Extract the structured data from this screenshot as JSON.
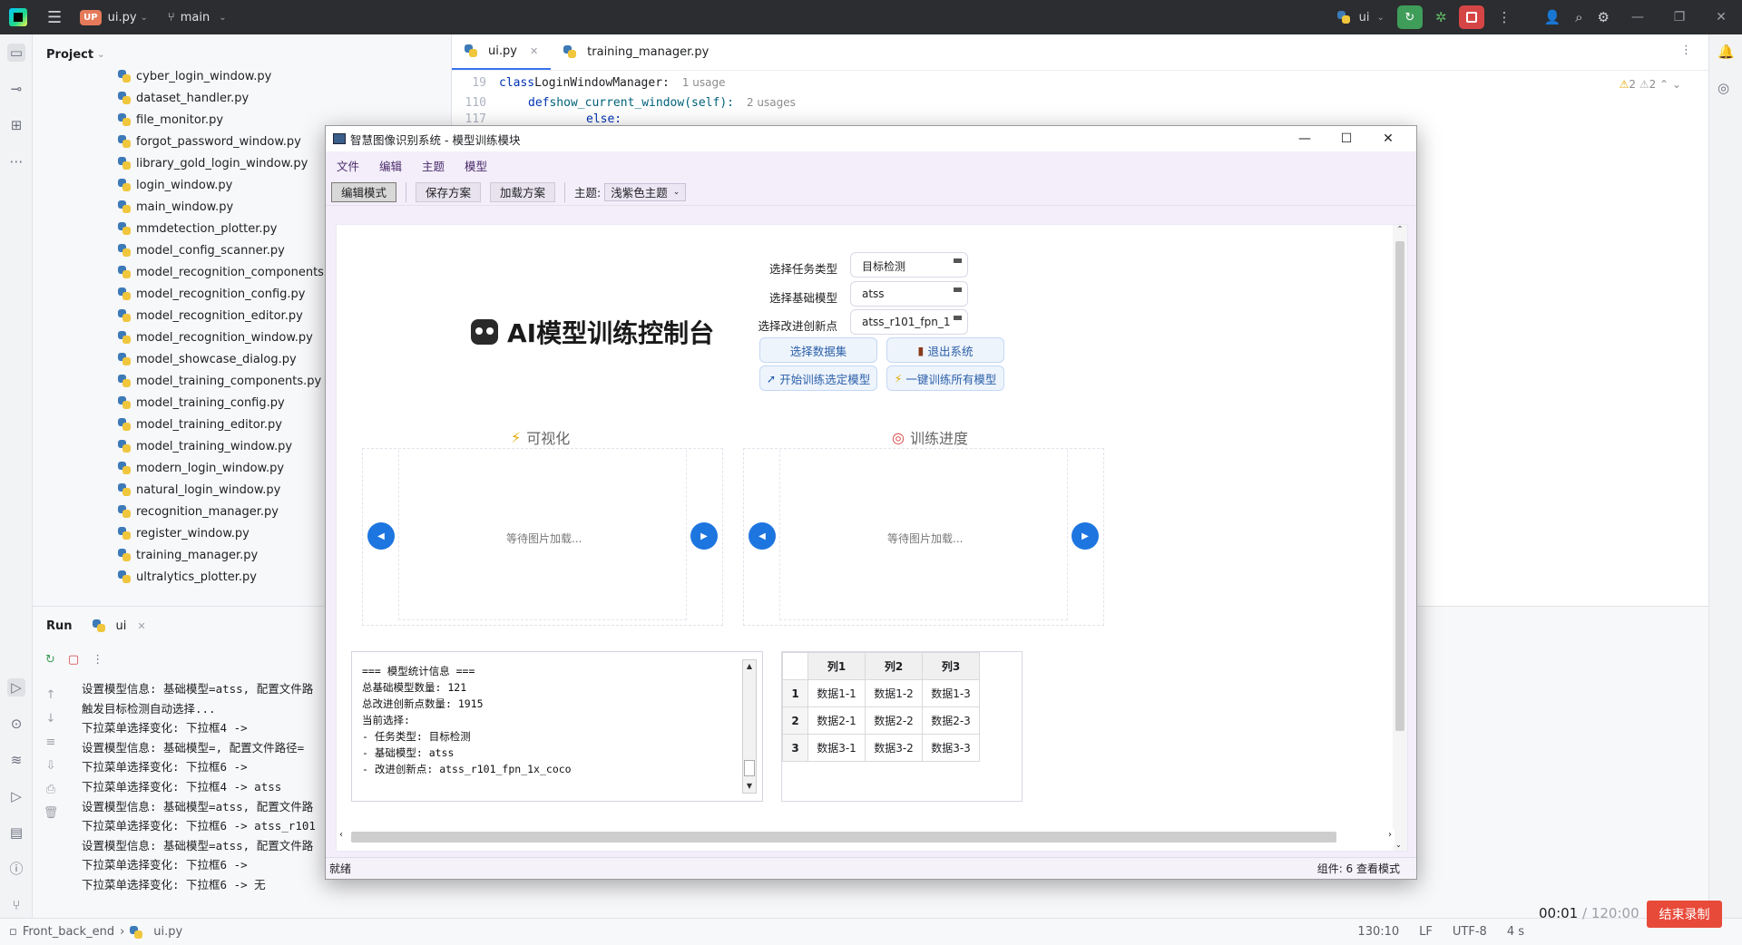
{
  "ide": {
    "project_badge": "UP",
    "project_name": "ui.py",
    "branch": "main",
    "run_config": "ui",
    "project_panel_title": "Project",
    "files": [
      "cyber_login_window.py",
      "dataset_handler.py",
      "file_monitor.py",
      "forgot_password_window.py",
      "library_gold_login_window.py",
      "login_window.py",
      "main_window.py",
      "mmdetection_plotter.py",
      "model_config_scanner.py",
      "model_recognition_components.py",
      "model_recognition_config.py",
      "model_recognition_editor.py",
      "model_recognition_window.py",
      "model_showcase_dialog.py",
      "model_training_components.py",
      "model_training_config.py",
      "model_training_editor.py",
      "model_training_window.py",
      "modern_login_window.py",
      "natural_login_window.py",
      "recognition_manager.py",
      "register_window.py",
      "training_manager.py",
      "ultralytics_plotter.py"
    ],
    "tabs": [
      {
        "label": "ui.py"
      },
      {
        "label": "training_manager.py"
      }
    ],
    "code": [
      {
        "line": "19",
        "kw": "class",
        "rest": " LoginWindowManager:",
        "usage": "1 usage"
      },
      {
        "line": "110",
        "kw": "def",
        "rest": " show_current_window(self):",
        "usage": "2 usages"
      },
      {
        "line": "117",
        "kw": "else:",
        "rest": "",
        "usage": ""
      }
    ],
    "warnings": {
      "a": "2",
      "b": "2"
    },
    "run_panel": {
      "title": "Run",
      "tab": "ui",
      "console": [
        "设置模型信息: 基础模型=atss, 配置文件路",
        "触发目标检测自动选择...",
        "下拉菜单选择变化: 下拉框4 ->",
        "设置模型信息: 基础模型=, 配置文件路径=",
        "下拉菜单选择变化: 下拉框6 ->",
        "下拉菜单选择变化: 下拉框4 -> atss",
        "设置模型信息: 基础模型=atss, 配置文件路",
        "下拉菜单选择变化: 下拉框6 -> atss_r101",
        "设置模型信息: 基础模型=atss, 配置文件路",
        "下拉菜单选择变化: 下拉框6 ->",
        "下拉菜单选择变化: 下拉框6 -> 无"
      ]
    },
    "status": {
      "crumb_root": "Front_back_end",
      "crumb_file": "ui.py",
      "position": "130:10",
      "line_sep": "LF",
      "encoding": "UTF-8",
      "indent": "4 s"
    },
    "recording": {
      "elapsed": "00:01",
      "total": "/ 120:00",
      "stop_label": "结束录制"
    }
  },
  "app": {
    "window_title": "智慧图像识别系统 - 模型训练模块",
    "menu": [
      "文件",
      "编辑",
      "主题",
      "模型"
    ],
    "toolbar": {
      "edit_mode": "编辑模式",
      "save_scheme": "保存方案",
      "load_scheme": "加载方案",
      "theme_label": "主题:",
      "theme_value": "浅紫色主题"
    },
    "main_title": "AI模型训练控制台",
    "form": {
      "task_label": "选择任务类型",
      "task_value": "目标检测",
      "model_label": "选择基础模型",
      "model_value": "atss",
      "improve_label": "选择改进创新点",
      "improve_value": "atss_r101_fpn_1"
    },
    "buttons": {
      "select_dataset": "选择数据集",
      "exit": "退出系统",
      "train_selected": "开始训练选定模型",
      "train_all": "一键训练所有模型"
    },
    "sections": {
      "visualization": "可视化",
      "progress": "训练进度"
    },
    "image_placeholder": "等待图片加载...",
    "stats": [
      "=== 模型统计信息 ===",
      "总基础模型数量: 121",
      "总改进创新点数量: 1915",
      "当前选择:",
      "- 任务类型: 目标检测",
      "- 基础模型: atss",
      "- 改进创新点: atss_r101_fpn_1x_coco"
    ],
    "table": {
      "headers": [
        "列1",
        "列2",
        "列3"
      ],
      "rows": [
        {
          "index": "1",
          "cells": [
            "数据1-1",
            "数据1-2",
            "数据1-3"
          ]
        },
        {
          "index": "2",
          "cells": [
            "数据2-1",
            "数据2-2",
            "数据2-3"
          ]
        },
        {
          "index": "3",
          "cells": [
            "数据3-1",
            "数据3-2",
            "数据3-3"
          ]
        }
      ]
    },
    "statusbar": {
      "left": "就绪",
      "right": "组件: 6  查看模式"
    }
  }
}
